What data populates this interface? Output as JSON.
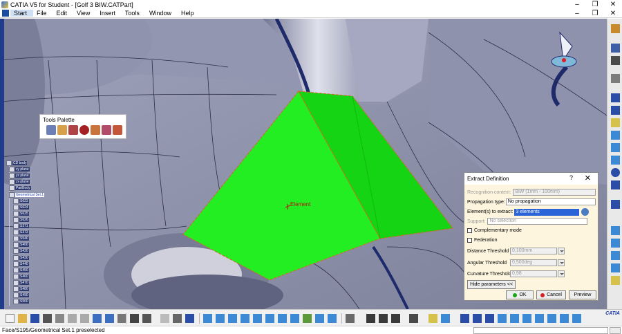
{
  "app": {
    "title": "CATIA V5 for Student - [Golf 3 BIW.CATPart]",
    "window_buttons": [
      "–",
      "❐",
      "✕"
    ]
  },
  "menu": {
    "items": [
      "Start",
      "File",
      "Edit",
      "View",
      "Insert",
      "Tools",
      "Window",
      "Help"
    ],
    "window_buttons": [
      "–",
      "❐",
      "✕"
    ]
  },
  "viewport": {
    "element_label": "Element",
    "background_color": "#8a8ea8",
    "highlight_color": "#22ee22"
  },
  "tools_palette": {
    "title": "Tools Palette",
    "icons": [
      "select-icon",
      "sketch-icon",
      "solid-icon",
      "record-icon",
      "measure-icon",
      "feature-icon",
      "export-icon"
    ]
  },
  "spec_tree": {
    "nodes": [
      {
        "label": "CD body",
        "selected": false
      },
      {
        "label": "xy plane",
        "selected": false
      },
      {
        "label": "yz plane",
        "selected": false
      },
      {
        "label": "zx plane",
        "selected": false
      },
      {
        "label": "PartBody",
        "selected": false
      },
      {
        "label": "Geometrical Set.1",
        "selected": true
      },
      {
        "label": "S623",
        "selected": false
      },
      {
        "label": "S624",
        "selected": false
      },
      {
        "label": "S625",
        "selected": false
      },
      {
        "label": "S626",
        "selected": false
      },
      {
        "label": "S371",
        "selected": false
      },
      {
        "label": "S373",
        "selected": false
      },
      {
        "label": "S540",
        "selected": false
      },
      {
        "label": "S400",
        "selected": false
      },
      {
        "label": "S420",
        "selected": false
      },
      {
        "label": "S430",
        "selected": false
      },
      {
        "label": "S440",
        "selected": false
      },
      {
        "label": "S450",
        "selected": false
      },
      {
        "label": "S460",
        "selected": false
      },
      {
        "label": "S470",
        "selected": false
      },
      {
        "label": "S480",
        "selected": false
      },
      {
        "label": "S490",
        "selected": false
      },
      {
        "label": "S500",
        "selected": false
      }
    ]
  },
  "extract_dialog": {
    "title": "Extract Definition",
    "help": "?",
    "close": "✕",
    "recognition_label": "Recognition context:",
    "recognition_value": "BiW (1mm - 100mm)",
    "propagation_label": "Propagation type:",
    "propagation_value": "No propagation",
    "elements_label": "Element(s) to extract:",
    "elements_value": "3 elements",
    "support_label": "Support:",
    "support_value": "No selection",
    "complementary_label": "Complementary mode",
    "federation_label": "Federation",
    "distance_label": "Distance Threshold",
    "distance_value": "0,100mm",
    "angular_label": "Angular Threshold",
    "angular_value": "0,500deg",
    "curvature_label": "Curvature Threshold",
    "curvature_value": "0,98",
    "hide_params_label": "Hide parameters <<",
    "ok_label": "OK",
    "cancel_label": "Cancel",
    "preview_label": "Preview"
  },
  "status": {
    "text": "Face/S195/Geometrical Set.1 preselected"
  },
  "branding": {
    "logo_text": "CATIA"
  }
}
